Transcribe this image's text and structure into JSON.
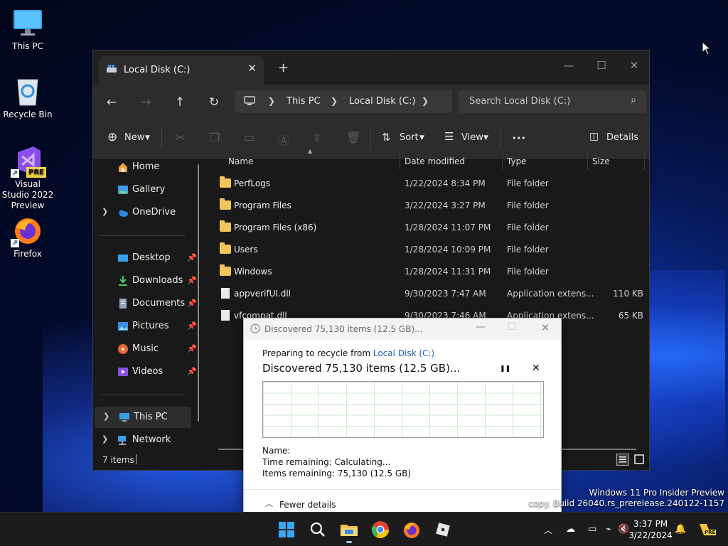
{
  "desktop": {
    "icons": [
      {
        "label": "This PC"
      },
      {
        "label": "Recycle Bin"
      },
      {
        "label": "Visual Studio 2022 Preview",
        "badge": "PRE"
      },
      {
        "label": "Firefox"
      }
    ],
    "watermark": {
      "line1": "Windows 11 Pro Insider Preview",
      "line2": "copy. Build 26040.rs_prerelease.240122-1157"
    }
  },
  "explorer": {
    "tab": {
      "title": "Local Disk (C:)",
      "close": "✕",
      "new_tab": "+"
    },
    "window_controls": {
      "minimize": "—",
      "maximize": "☐",
      "close": "✕"
    },
    "nav": {
      "back": "←",
      "forward": "→",
      "up": "↑",
      "refresh": "↻"
    },
    "breadcrumbs": [
      "This PC",
      "Local Disk (C:)"
    ],
    "search_placeholder": "Search Local Disk (C:)",
    "commands": {
      "new": "New",
      "sort": "Sort",
      "view": "View",
      "more": "•••",
      "details": "Details"
    },
    "nav_pane": {
      "top": [
        {
          "label": "Home"
        },
        {
          "label": "Gallery"
        },
        {
          "label": "OneDrive"
        }
      ],
      "quick_access": [
        {
          "label": "Desktop"
        },
        {
          "label": "Downloads"
        },
        {
          "label": "Documents"
        },
        {
          "label": "Pictures"
        },
        {
          "label": "Music"
        },
        {
          "label": "Videos"
        }
      ],
      "bottom": [
        {
          "label": "This PC"
        },
        {
          "label": "Network"
        }
      ]
    },
    "columns": {
      "name": "Name",
      "date": "Date modified",
      "type": "Type",
      "size": "Size"
    },
    "files": [
      {
        "name": "PerfLogs",
        "date": "1/22/2024 8:34 PM",
        "type": "File folder",
        "size": "",
        "kind": "folder"
      },
      {
        "name": "Program Files",
        "date": "3/22/2024 3:27 PM",
        "type": "File folder",
        "size": "",
        "kind": "folder"
      },
      {
        "name": "Program Files (x86)",
        "date": "1/28/2024 11:07 PM",
        "type": "File folder",
        "size": "",
        "kind": "folder"
      },
      {
        "name": "Users",
        "date": "1/28/2024 10:09 PM",
        "type": "File folder",
        "size": "",
        "kind": "folder"
      },
      {
        "name": "Windows",
        "date": "1/28/2024 11:31 PM",
        "type": "File folder",
        "size": "",
        "kind": "folder"
      },
      {
        "name": "appverifUI.dll",
        "date": "9/30/2023 7:47 AM",
        "type": "Application extens...",
        "size": "110 KB",
        "kind": "file"
      },
      {
        "name": "vfcompat.dll",
        "date": "9/30/2023 7:46 AM",
        "type": "Application extens...",
        "size": "65 KB",
        "kind": "file"
      }
    ],
    "status": "7 items"
  },
  "dialog": {
    "title": "Discovered 75,130 items (12.5 GB)...",
    "preparing_prefix": "Preparing to recycle from",
    "preparing_link": "Local Disk (C:)",
    "headline": "Discovered 75,130 items (12.5 GB)...",
    "pause": "❚❚",
    "cancel": "✕",
    "name_label": "Name:",
    "time_remaining": "Time remaining:  Calculating...",
    "items_remaining": "Items remaining:  75,130 (12.5 GB)",
    "fewer_details": "Fewer details",
    "controls": {
      "minimize": "—",
      "maximize": "☐",
      "close": "✕"
    }
  },
  "taskbar": {
    "time": "3:37 PM",
    "date": "3/22/2024",
    "tray_badge": "PRE"
  }
}
